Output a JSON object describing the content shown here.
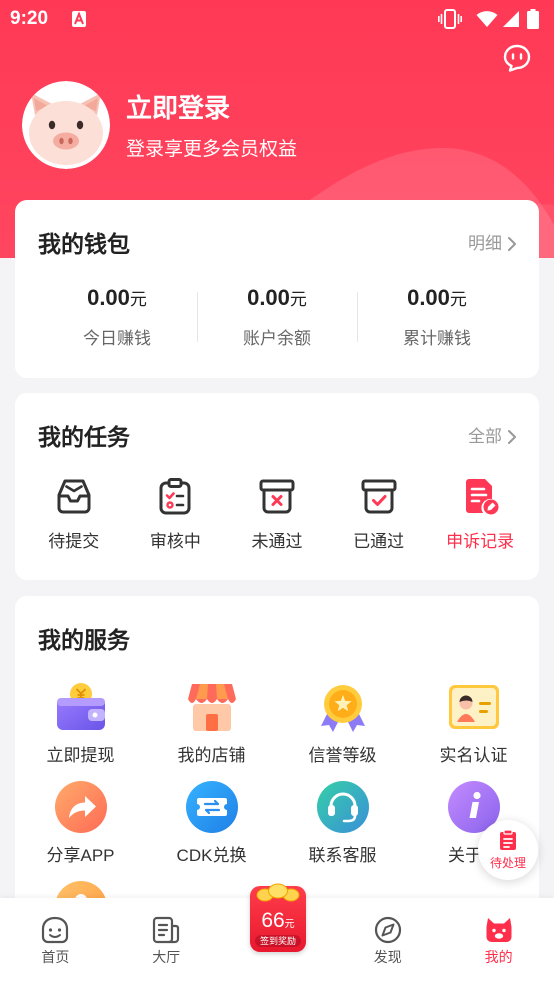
{
  "status_bar": {
    "time": "9:20",
    "icons": [
      "app-notification-icon",
      "vibrate-icon",
      "wifi-icon",
      "signal-icon",
      "battery-icon"
    ]
  },
  "header": {
    "login_title": "立即登录",
    "login_subtitle": "登录享更多会员权益",
    "avatar_icon": "pig-avatar-icon",
    "message_icon": "chat-bubble-icon"
  },
  "wallet": {
    "title": "我的钱包",
    "detail_link": "明细",
    "stats": [
      {
        "value": "0.00",
        "unit": "元",
        "label": "今日赚钱"
      },
      {
        "value": "0.00",
        "unit": "元",
        "label": "账户余额"
      },
      {
        "value": "0.00",
        "unit": "元",
        "label": "累计赚钱"
      }
    ]
  },
  "tasks": {
    "title": "我的任务",
    "all_link": "全部",
    "items": [
      {
        "label": "待提交",
        "icon": "inbox-tray-icon"
      },
      {
        "label": "审核中",
        "icon": "clipboard-review-icon"
      },
      {
        "label": "未通过",
        "icon": "box-x-icon"
      },
      {
        "label": "已通过",
        "icon": "box-check-icon"
      },
      {
        "label": "申诉记录",
        "icon": "appeal-record-icon",
        "highlight": true
      }
    ]
  },
  "services": {
    "title": "我的服务",
    "items": [
      {
        "label": "立即提现",
        "icon": "wallet-coin-icon"
      },
      {
        "label": "我的店铺",
        "icon": "store-icon"
      },
      {
        "label": "信誉等级",
        "icon": "medal-icon"
      },
      {
        "label": "实名认证",
        "icon": "id-card-icon"
      },
      {
        "label": "分享APP",
        "icon": "share-icon"
      },
      {
        "label": "CDK兑换",
        "icon": "ticket-exchange-icon"
      },
      {
        "label": "联系客服",
        "icon": "headset-icon"
      },
      {
        "label": "关于我",
        "icon": "info-icon"
      },
      {
        "icon": "orange-circle-icon"
      }
    ]
  },
  "floating_button": {
    "label": "待处理",
    "icon": "pending-doc-icon"
  },
  "bottom_nav": {
    "items": [
      {
        "label": "首页",
        "icon": "home-smile-icon"
      },
      {
        "label": "大厅",
        "icon": "hall-document-icon"
      },
      {
        "label": "发现",
        "icon": "compass-icon"
      },
      {
        "label": "我的",
        "icon": "pig-profile-icon",
        "active": true
      }
    ],
    "center_badge": {
      "amount": "66",
      "unit": "元",
      "caption": "签到奖励",
      "icon": "gold-coins-icon"
    }
  },
  "colors": {
    "primary": "#ff3955",
    "active": "#ff2f4c",
    "text": "#222222",
    "muted": "#999999",
    "background": "#f4f4f6"
  }
}
